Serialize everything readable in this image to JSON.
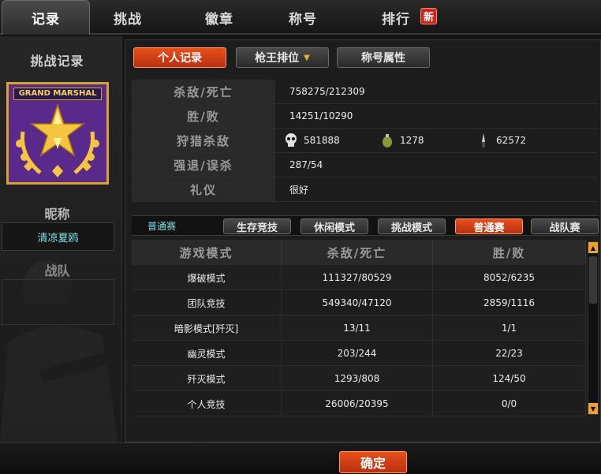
{
  "tabs": [
    {
      "label": "记录",
      "active": true
    },
    {
      "label": "挑战",
      "active": false
    },
    {
      "label": "徽章",
      "active": false
    },
    {
      "label": "称号",
      "active": false
    },
    {
      "label": "排行",
      "active": false
    }
  ],
  "new_badge": "新",
  "left": {
    "title": "挑战记录",
    "rank_label": "GRAND MARSHAL",
    "nickname_title": "昵称",
    "nickname": "清凉夏鸥",
    "team_title": "战队"
  },
  "subtabs": {
    "personal": "个人记录",
    "gunking": "枪王排位",
    "title_attr": "称号属性"
  },
  "stats": {
    "kd_label": "杀敌/死亡",
    "kd_value": "758275/212309",
    "wl_label": "胜/败",
    "wl_value": "14251/10290",
    "special_label": "狩猎杀敌",
    "headshot": "581888",
    "grenade": "1278",
    "knife": "62572",
    "escape_label": "强退/误杀",
    "escape_value": "287/54",
    "etiquette_label": "礼仪",
    "etiquette_value": "很好"
  },
  "modes": {
    "current": "普通赛",
    "buttons": [
      "生存竞技",
      "休闲模式",
      "挑战模式",
      "普通赛",
      "战队赛"
    ],
    "active_index": 3
  },
  "table": {
    "headers": [
      "游戏模式",
      "杀敌/死亡",
      "胜/败"
    ],
    "rows": [
      [
        "爆破模式",
        "111327/80529",
        "8052/6235"
      ],
      [
        "团队竞技",
        "549340/47120",
        "2859/1116"
      ],
      [
        "暗影模式[歼灭]",
        "13/11",
        "1/1"
      ],
      [
        "幽灵模式",
        "203/244",
        "22/23"
      ],
      [
        "歼灭模式",
        "1293/808",
        "124/50"
      ],
      [
        "个人竞技",
        "26006/20395",
        "0/0"
      ]
    ]
  },
  "confirm": "确定",
  "colors": {
    "accent": "#e8501c",
    "nickname": "#7fe0e8",
    "rank_bg": "#5a2a8a",
    "gold": "#d4a52a"
  }
}
